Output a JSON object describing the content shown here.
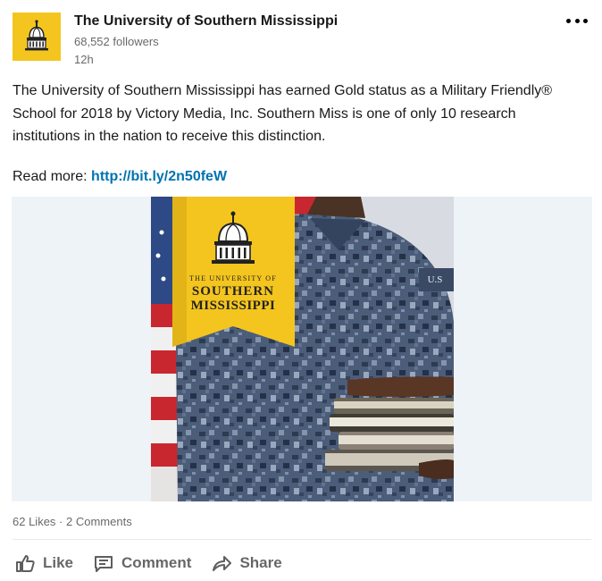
{
  "author": {
    "name": "The University of Southern Mississippi",
    "followers": "68,552 followers",
    "time": "12h",
    "logo": "university-dome-logo"
  },
  "post": {
    "text": "The University of Southern Mississippi has earned Gold status as a Military Friendly® School for 2018 by Victory Media, Inc. Southern Miss is one of only 10 research institutions in the nation to receive this distinction.",
    "read_more_label": "Read more:",
    "link": "http://bit.ly/2n50feW"
  },
  "image": {
    "banner_line1": "THE UNIVERSITY OF",
    "banner_line2": "SOUTHERN",
    "banner_line3": "MISSISSIPPI",
    "uniform_text": "U.S"
  },
  "social": {
    "likes": "62 Likes",
    "separator": "·",
    "comments": "2 Comments"
  },
  "actions": {
    "like": "Like",
    "comment": "Comment",
    "share": "Share"
  },
  "colors": {
    "gold": "#f4c51f",
    "link": "#0073b1",
    "muted": "#666666"
  }
}
